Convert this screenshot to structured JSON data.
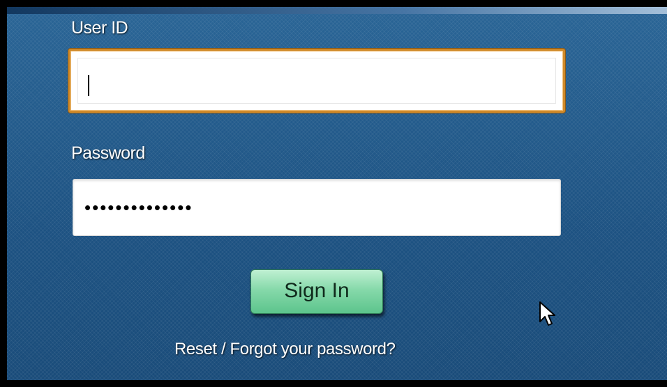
{
  "login": {
    "userid_label": "User ID",
    "userid_value": "",
    "password_label": "Password",
    "password_mask": "••••••••••••••",
    "signin_label": "Sign In",
    "forgot_link": "Reset / Forgot your password?"
  },
  "colors": {
    "panel_background": "#1f5585",
    "focus_border": "#d08a2a",
    "button_green": "#86d9aa",
    "label_text": "#ffffff"
  },
  "icons": {
    "pointer": "arrow-cursor-icon"
  }
}
